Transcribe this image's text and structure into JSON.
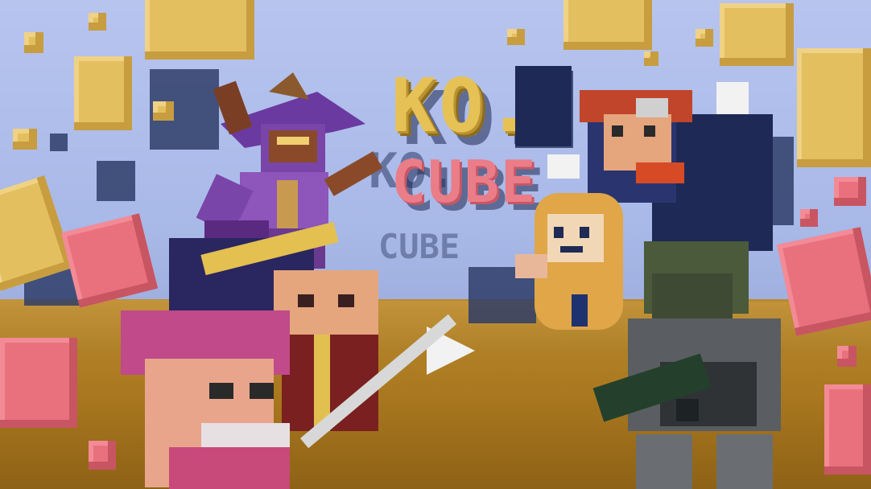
{
  "title": {
    "line1": "KO.",
    "line2": "CUBE"
  },
  "colors": {
    "sky": "#a9b9e8",
    "floor": "#a9781f",
    "gold_cube": "#e3bf5f",
    "pink_cube": "#e9717e",
    "shadow": "#2f3d68"
  },
  "characters": [
    {
      "id": "purple-witch",
      "icon": "witch-character"
    },
    {
      "id": "red-haired-scientist",
      "icon": "scientist-character"
    },
    {
      "id": "hooded-kid",
      "icon": "hooded-character"
    },
    {
      "id": "armored-soldier",
      "icon": "soldier-character"
    },
    {
      "id": "pink-beanie-brawler",
      "icon": "brawler-character"
    },
    {
      "id": "bearded-monk",
      "icon": "monk-character"
    }
  ]
}
